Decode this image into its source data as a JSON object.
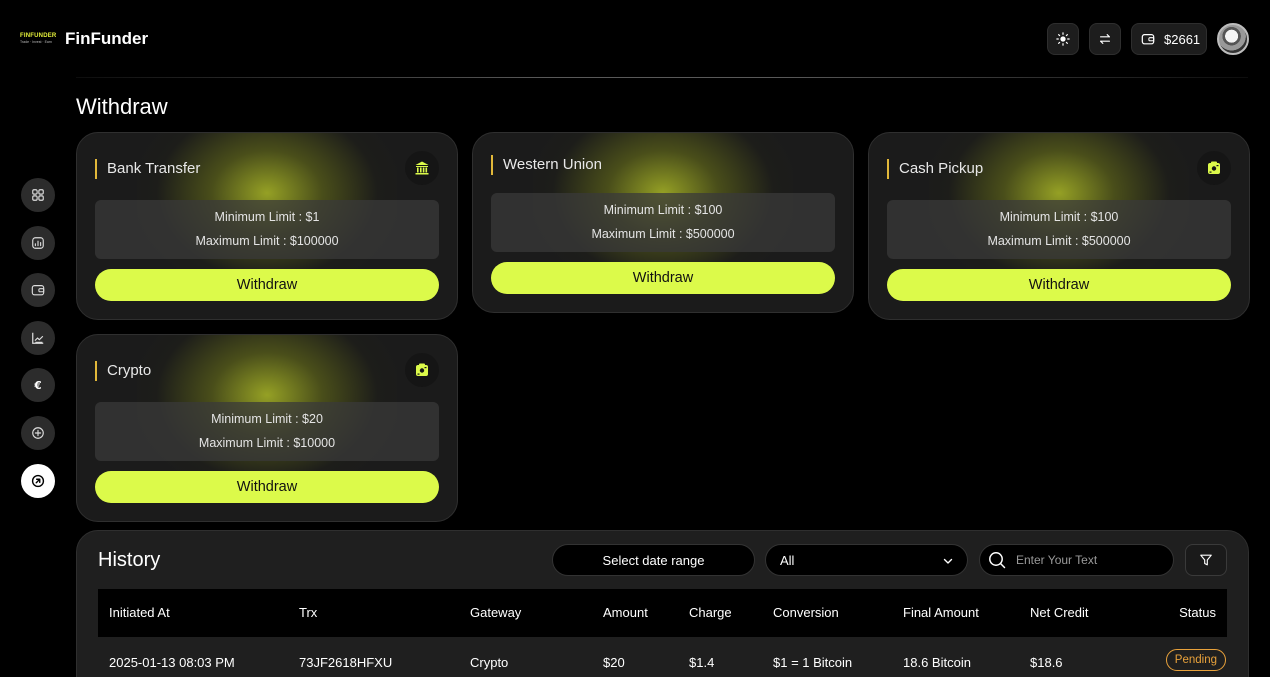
{
  "header": {
    "logo_text": "FINFUNDER",
    "logo_tagline": "Trade · Invest · Earn",
    "brand": "FinFunder",
    "theme_icon": "sun-icon",
    "swap_icon": "swap-arrows-icon",
    "wallet_icon": "wallet-icon",
    "wallet_balance": "$2661"
  },
  "sidebar": {
    "items": [
      {
        "icon": "grid-icon",
        "active": false
      },
      {
        "icon": "chart-box-icon",
        "active": false
      },
      {
        "icon": "wallet-icon",
        "active": false
      },
      {
        "icon": "trend-chart-icon",
        "active": false
      },
      {
        "icon": "euro-icon",
        "active": false
      },
      {
        "icon": "plus-circle-icon",
        "active": false
      },
      {
        "icon": "arrow-up-right-circle-icon",
        "active": true
      }
    ]
  },
  "page": {
    "title": "Withdraw"
  },
  "methods": [
    {
      "name": "Bank Transfer",
      "icon": "bank-icon",
      "min": "Minimum Limit : $1",
      "max": "Maximum Limit : $100000",
      "button": "Withdraw"
    },
    {
      "name": "Western Union",
      "icon": "",
      "min": "Minimum Limit : $100",
      "max": "Maximum Limit : $500000",
      "button": "Withdraw"
    },
    {
      "name": "Cash Pickup",
      "icon": "cash-bag-icon",
      "min": "Minimum Limit : $100",
      "max": "Maximum Limit : $500000",
      "button": "Withdraw"
    },
    {
      "name": "Crypto",
      "icon": "cash-bag-icon",
      "min": "Minimum Limit : $20",
      "max": "Maximum Limit : $10000",
      "button": "Withdraw"
    }
  ],
  "history": {
    "title": "History",
    "date_range_label": "Select date range",
    "filter_select": {
      "selected": "All"
    },
    "search_placeholder": "Enter Your Text",
    "filter_icon": "filter-icon",
    "columns": [
      "Initiated At",
      "Trx",
      "Gateway",
      "Amount",
      "Charge",
      "Conversion",
      "Final Amount",
      "Net Credit",
      "Status"
    ],
    "rows": [
      [
        "2025-01-13 08:03 PM",
        "73JF2618HFXU",
        "Crypto",
        "$20",
        "$1.4",
        "$1 = 1 Bitcoin",
        "18.6 Bitcoin",
        "$18.6",
        "Pending"
      ]
    ]
  },
  "colors": {
    "accent": "#dcfa4a",
    "title_bar": "#e2b83a",
    "status_pending": "#e9a23b",
    "card_bg": "#1b1b1b",
    "page_bg": "#000000"
  }
}
